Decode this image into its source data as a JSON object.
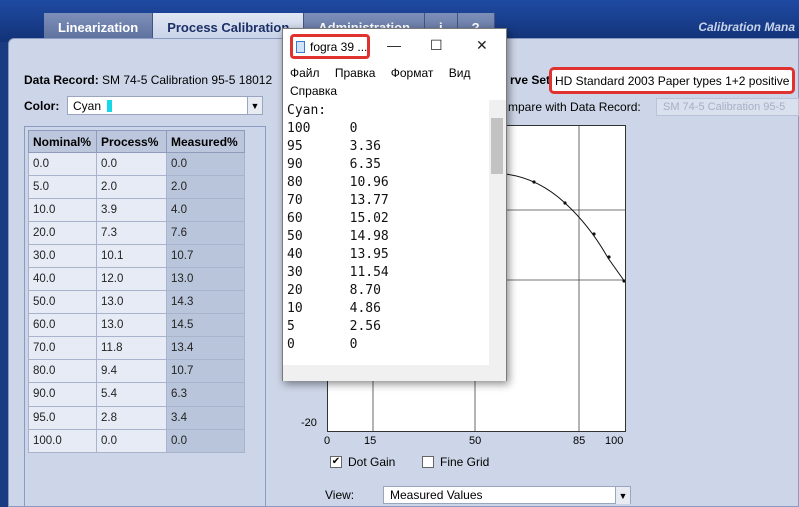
{
  "app": {
    "tabs": [
      "Linearization",
      "Process Calibration",
      "Administration",
      "i",
      "?"
    ],
    "active_tab": 1,
    "brand": "Calibration Mana"
  },
  "data_record": {
    "label": "Data Record:",
    "value": "SM 74-5 Calibration 95-5 18012"
  },
  "color": {
    "label": "Color:",
    "value": "Cyan"
  },
  "curve_set": {
    "label_tail": "rve Set:",
    "value": "HD Standard 2003 Paper types 1+2 positive"
  },
  "compare": {
    "label": "mpare with Data Record:",
    "value": "SM 74-5 Calibration 95-5"
  },
  "table": {
    "headers": [
      "Nominal%",
      "Process%",
      "Measured%"
    ],
    "rows": [
      [
        "0.0",
        "0.0",
        "0.0"
      ],
      [
        "5.0",
        "2.0",
        "2.0"
      ],
      [
        "10.0",
        "3.9",
        "4.0"
      ],
      [
        "20.0",
        "7.3",
        "7.6"
      ],
      [
        "30.0",
        "10.1",
        "10.7"
      ],
      [
        "40.0",
        "12.0",
        "13.0"
      ],
      [
        "50.0",
        "13.0",
        "14.3"
      ],
      [
        "60.0",
        "13.0",
        "14.5"
      ],
      [
        "70.0",
        "11.8",
        "13.4"
      ],
      [
        "80.0",
        "9.4",
        "10.7"
      ],
      [
        "90.0",
        "5.4",
        "6.3"
      ],
      [
        "95.0",
        "2.8",
        "3.4"
      ],
      [
        "100.0",
        "0.0",
        "0.0"
      ]
    ]
  },
  "plot": {
    "y_tick": "-20",
    "x_ticks": [
      "0",
      "15",
      "50",
      "85",
      "100"
    ]
  },
  "options": {
    "dot_gain": {
      "label": "Dot Gain",
      "checked": true
    },
    "fine_grid": {
      "label": "Fine Grid",
      "checked": false
    }
  },
  "view": {
    "label": "View:",
    "value": "Measured Values"
  },
  "notepad": {
    "title": "fogra 39 ...",
    "menu": [
      "Файл",
      "Правка",
      "Формат",
      "Вид",
      "Справка"
    ],
    "content": "Cyan:\n100     0\n95      3.36\n90      6.35\n80      10.96\n70      13.77\n60      15.02\n50      14.98\n40      13.95\n30      11.54\n20      8.70\n10      4.86\n5       2.56\n0       0"
  }
}
